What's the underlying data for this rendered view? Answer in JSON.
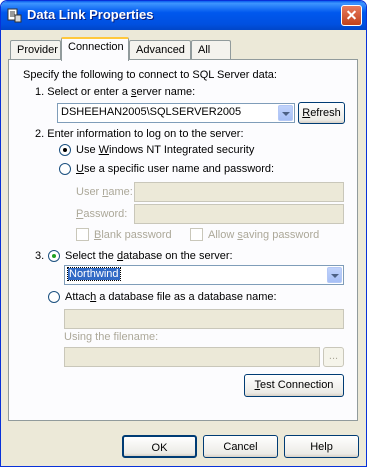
{
  "window": {
    "title": "Data Link Properties"
  },
  "tabs": [
    "Provider",
    "Connection",
    "Advanced",
    "All"
  ],
  "intro": "Specify the following to connect to SQL Server data:",
  "step1": {
    "label_pre": "1. Select or enter a ",
    "label_ul": "s",
    "label_post": "erver name:",
    "server_value": "DSHEEHAN2005\\SQLSERVER2005",
    "refresh_ul": "R",
    "refresh_rest": "efresh"
  },
  "step2": {
    "label": "2. Enter information to log on to the server:",
    "opt_windows_pre": "Use ",
    "opt_windows_ul": "W",
    "opt_windows_post": "indows NT Integrated security",
    "opt_specific_ul": "U",
    "opt_specific_post": "se a specific user name and password:",
    "username_ul": "n",
    "username_pre": "User ",
    "username_post": "ame:",
    "password_ul": "P",
    "password_post": "assword:",
    "blank_ul": "B",
    "blank_post": "lank password",
    "allow_pre": "Allow ",
    "allow_ul": "s",
    "allow_post": "aving password"
  },
  "step3": {
    "number": "3.",
    "opt_select_pre": "Select the ",
    "opt_select_ul": "d",
    "opt_select_post": "atabase on the server:",
    "database_value": "Northwind",
    "opt_attach_pre": "Attac",
    "opt_attach_ul": "h",
    "opt_attach_post": " a database file as a database name:",
    "filename_label": "Using the filename:",
    "browse": "..."
  },
  "test_connection": {
    "ul": "T",
    "rest": "est Connection"
  },
  "buttons": {
    "ok": "OK",
    "cancel": "Cancel",
    "help": "Help"
  }
}
